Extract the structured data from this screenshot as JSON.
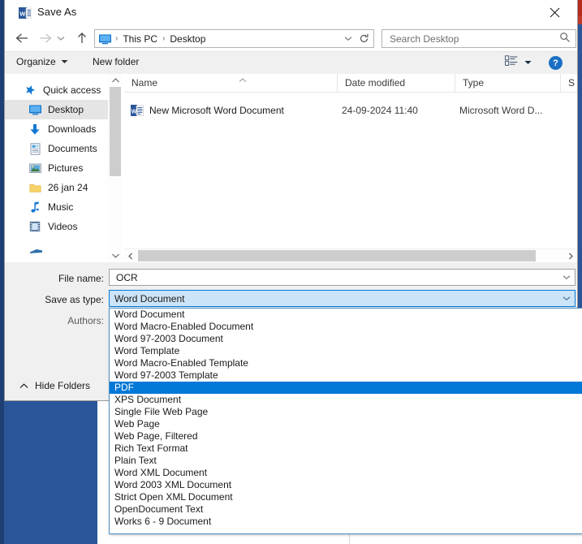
{
  "window": {
    "title": "Save As",
    "app_icon": "word-icon",
    "close_label": "✕"
  },
  "nav": {
    "back_icon": "back-arrow-icon",
    "forward_icon": "forward-arrow-icon",
    "recent_icon": "recent-locations-icon",
    "up_icon": "up-arrow-icon",
    "refresh_icon": "refresh-icon",
    "breadcrumb": [
      "This PC",
      "Desktop"
    ],
    "separator": "›"
  },
  "search": {
    "placeholder": "Search Desktop",
    "value": "",
    "icon": "search-icon"
  },
  "toolbar": {
    "organize_label": "Organize",
    "new_folder_label": "New folder",
    "view_icon": "view-layout-icon",
    "help_label": "?"
  },
  "sidebar": {
    "items": [
      {
        "label": "Quick access",
        "icon": "star-icon",
        "pinned": false,
        "selected": false
      },
      {
        "label": "Desktop",
        "icon": "desktop-icon",
        "pinned": true,
        "selected": true
      },
      {
        "label": "Downloads",
        "icon": "download-icon",
        "pinned": true,
        "selected": false
      },
      {
        "label": "Documents",
        "icon": "documents-icon",
        "pinned": true,
        "selected": false
      },
      {
        "label": "Pictures",
        "icon": "pictures-icon",
        "pinned": true,
        "selected": false
      },
      {
        "label": "26 jan 24",
        "icon": "folder-icon",
        "pinned": false,
        "selected": false
      },
      {
        "label": "Music",
        "icon": "music-icon",
        "pinned": false,
        "selected": false
      },
      {
        "label": "Videos",
        "icon": "videos-icon",
        "pinned": false,
        "selected": false
      }
    ]
  },
  "filelist": {
    "columns": [
      "Name",
      "Date modified",
      "Type",
      "S"
    ],
    "rows": [
      {
        "name": "New Microsoft Word Document",
        "date_modified": "24-09-2024 11:40",
        "type": "Microsoft Word D...",
        "icon": "word-document-icon"
      }
    ]
  },
  "form": {
    "filename_label": "File name:",
    "filename_value": "OCR",
    "savetype_label": "Save as type:",
    "savetype_value": "Word Document",
    "authors_label": "Authors:",
    "authors_value": "",
    "hide_folders_label": "Hide Folders"
  },
  "dropdown": {
    "selected": "PDF",
    "options": [
      "Word Document",
      "Word Macro-Enabled Document",
      "Word 97-2003 Document",
      "Word Template",
      "Word Macro-Enabled Template",
      "Word 97-2003 Template",
      "PDF",
      "XPS Document",
      "Single File Web Page",
      "Web Page",
      "Web Page, Filtered",
      "Rich Text Format",
      "Plain Text",
      "Word XML Document",
      "Word 2003 XML Document",
      "Strict Open XML Document",
      "OpenDocument Text",
      "Works 6 - 9 Document"
    ]
  },
  "colors": {
    "accent": "#0078d7",
    "desktop": "#2a5699",
    "selected_row": "#0078d7",
    "combo_focus": "#cce4f7"
  }
}
